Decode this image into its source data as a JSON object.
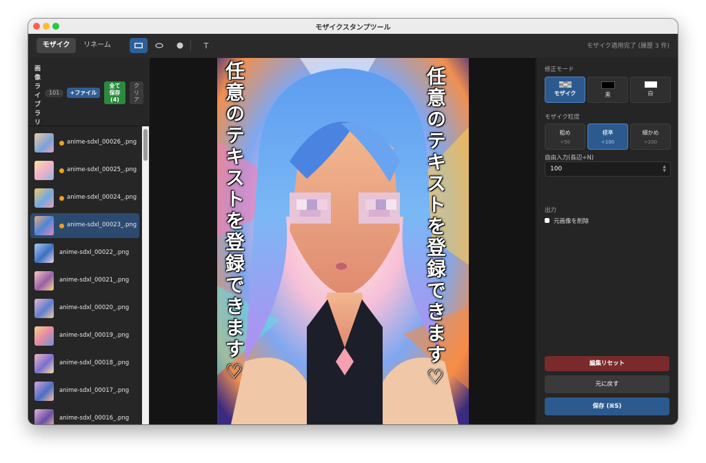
{
  "window": {
    "title": "モザイクスタンプツール"
  },
  "toolbar": {
    "tabs": [
      "モザイク",
      "リネーム"
    ],
    "tools": [
      "rectangle-icon",
      "ellipse-icon",
      "circle-icon",
      "text-icon"
    ],
    "text_tool_label": "T",
    "status": "モザイク適用完了 (履歴 3 件)"
  },
  "sidebar": {
    "title": "画像ライブラリ",
    "count": "101",
    "add_file": "+ファイル",
    "save_all": [
      "全て",
      "保存",
      "(4)"
    ],
    "clear": [
      "ク",
      "リ",
      "ア"
    ],
    "files": [
      {
        "name": "anime-sdxl_00026_.png",
        "modified": true,
        "selected": false
      },
      {
        "name": "anime-sdxl_00025_.png",
        "modified": true,
        "selected": false
      },
      {
        "name": "anime-sdxl_00024_.png",
        "modified": true,
        "selected": false
      },
      {
        "name": "anime-sdxl_00023_.png",
        "modified": true,
        "selected": true
      },
      {
        "name": "anime-sdxl_00022_.png",
        "modified": false,
        "selected": false
      },
      {
        "name": "anime-sdxl_00021_.png",
        "modified": false,
        "selected": false
      },
      {
        "name": "anime-sdxl_00020_.png",
        "modified": false,
        "selected": false
      },
      {
        "name": "anime-sdxl_00019_.png",
        "modified": false,
        "selected": false
      },
      {
        "name": "anime-sdxl_00018_.png",
        "modified": false,
        "selected": false
      },
      {
        "name": "anime-sdxl_00017_.png",
        "modified": false,
        "selected": false
      },
      {
        "name": "anime-sdxl_00016_.png",
        "modified": false,
        "selected": false
      }
    ]
  },
  "canvas": {
    "overlay_text_right": "任意のテキストを登録できます♡",
    "overlay_text_left": "任意のテキストを登録できます♡"
  },
  "panel": {
    "mode_label": "修正モード",
    "modes": [
      {
        "label": "モザイク",
        "active": true
      },
      {
        "label": "黒",
        "active": false
      },
      {
        "label": "白",
        "active": false
      }
    ],
    "granularity_label": "モザイク粒度",
    "granularities": [
      {
        "label": "粗め",
        "sub": "÷50",
        "active": false
      },
      {
        "label": "標準",
        "sub": "÷100",
        "active": true
      },
      {
        "label": "細かめ",
        "sub": "÷200",
        "active": false
      }
    ],
    "free_input_label": "自由入力(長辺÷N)",
    "free_input_value": "100",
    "output_label": "出力",
    "delete_original_label": "元画像を削除",
    "reset_button": "編集リセット",
    "undo_button": "元に戻す",
    "save_button": "保存 (⌘S)"
  },
  "colors": {
    "accent": "#2c5a8f",
    "save_all_green": "#2b8a3e",
    "reset_red": "#7a2a2a",
    "modified_dot": "#f0a020"
  }
}
